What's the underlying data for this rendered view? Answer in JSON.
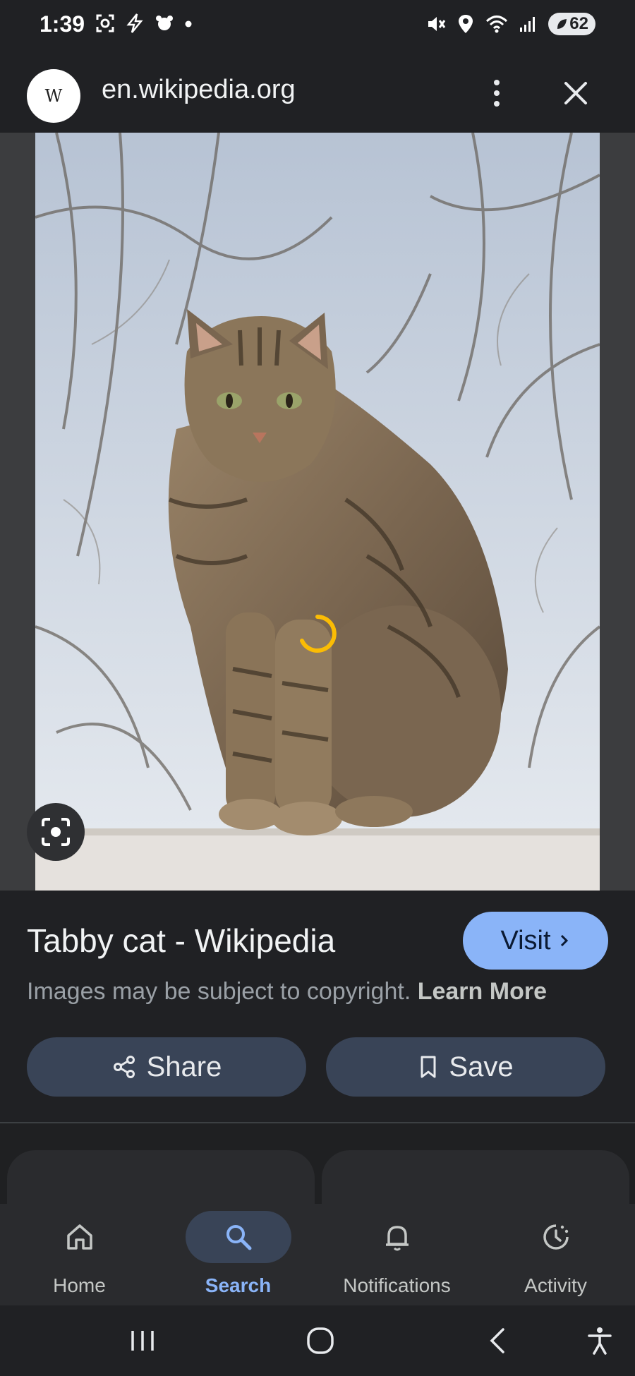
{
  "status_bar": {
    "time": "1:39",
    "battery": "62"
  },
  "header": {
    "site_logo": "W",
    "url": "en.wikipedia.org"
  },
  "image": {
    "subject": "tabby cat sitting on a stone wall",
    "loading": true
  },
  "result": {
    "title": "Tabby cat - Wikipedia",
    "visit_label": "Visit",
    "copyright_text": "Images may be subject to copyright.",
    "learn_more_label": "Learn More",
    "share_label": "Share",
    "save_label": "Save"
  },
  "bottom_nav": {
    "items": [
      {
        "label": "Home",
        "icon": "home-icon",
        "active": false
      },
      {
        "label": "Search",
        "icon": "search-icon",
        "active": true
      },
      {
        "label": "Notifications",
        "icon": "bell-icon",
        "active": false
      },
      {
        "label": "Activity",
        "icon": "activity-icon",
        "active": false
      }
    ]
  },
  "colors": {
    "background": "#202124",
    "accent": "#8ab4f8",
    "button": "#394457",
    "spinner": "#fbbc04"
  }
}
